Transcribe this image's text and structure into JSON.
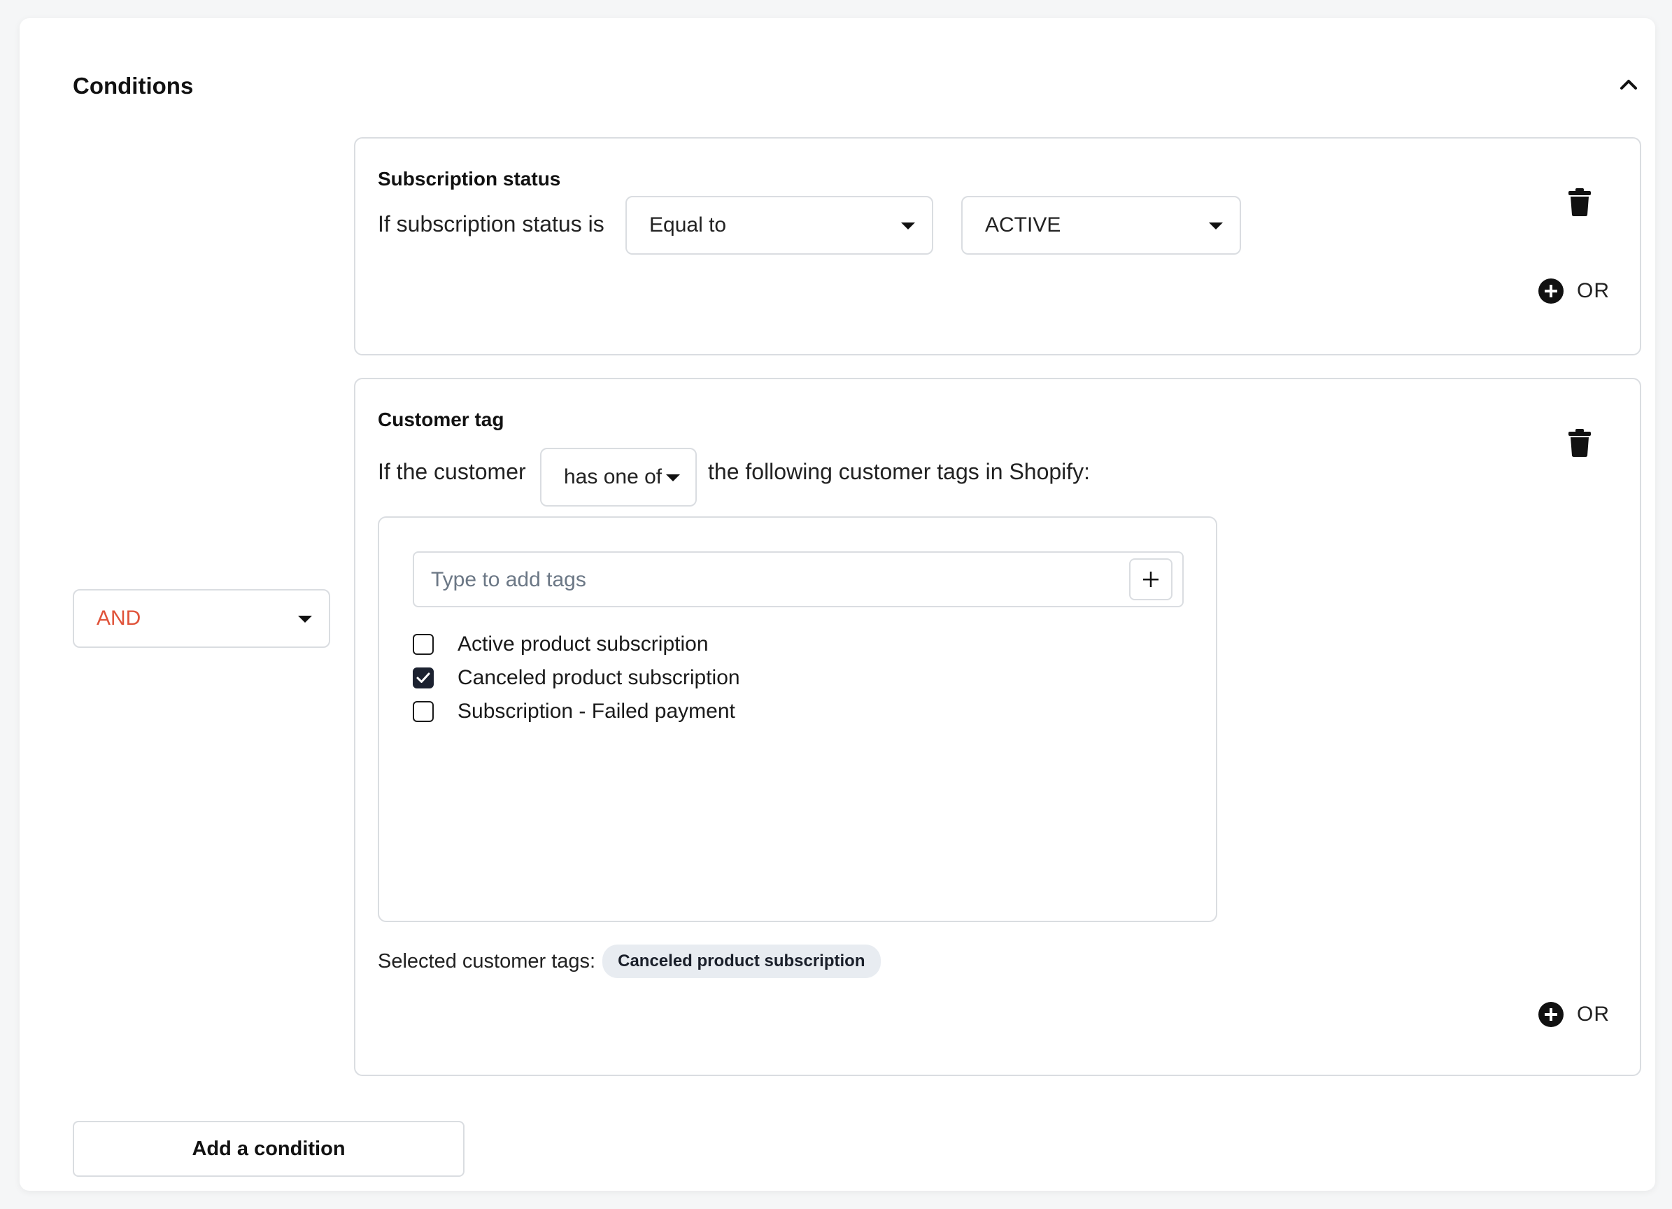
{
  "panel": {
    "title": "Conditions",
    "collapse_icon": "chevron-up-icon"
  },
  "connector": {
    "selected": "AND",
    "color": "#e0533a"
  },
  "condition_1": {
    "title": "Subscription status",
    "prefix": "If subscription status is",
    "operator": "Equal to",
    "value": "ACTIVE",
    "or_label": "OR",
    "delete_icon": "trash-icon",
    "or_icon": "plus-circle-icon"
  },
  "condition_2": {
    "title": "Customer tag",
    "prefix": "If the customer",
    "operator": "has one of",
    "suffix": "the following customer tags in Shopify:",
    "tag_input_placeholder": "Type to add tags",
    "add_tag_icon": "plus-icon",
    "tags": [
      {
        "label": "Active product subscription",
        "checked": false
      },
      {
        "label": "Canceled product subscription",
        "checked": true
      },
      {
        "label": "Subscription - Failed payment",
        "checked": false
      }
    ],
    "selected_label": "Selected customer tags:",
    "selected_tags": [
      "Canceled product subscription"
    ],
    "or_label": "OR",
    "delete_icon": "trash-icon",
    "or_icon": "plus-circle-icon"
  },
  "footer": {
    "add_condition_label": "Add a condition"
  }
}
